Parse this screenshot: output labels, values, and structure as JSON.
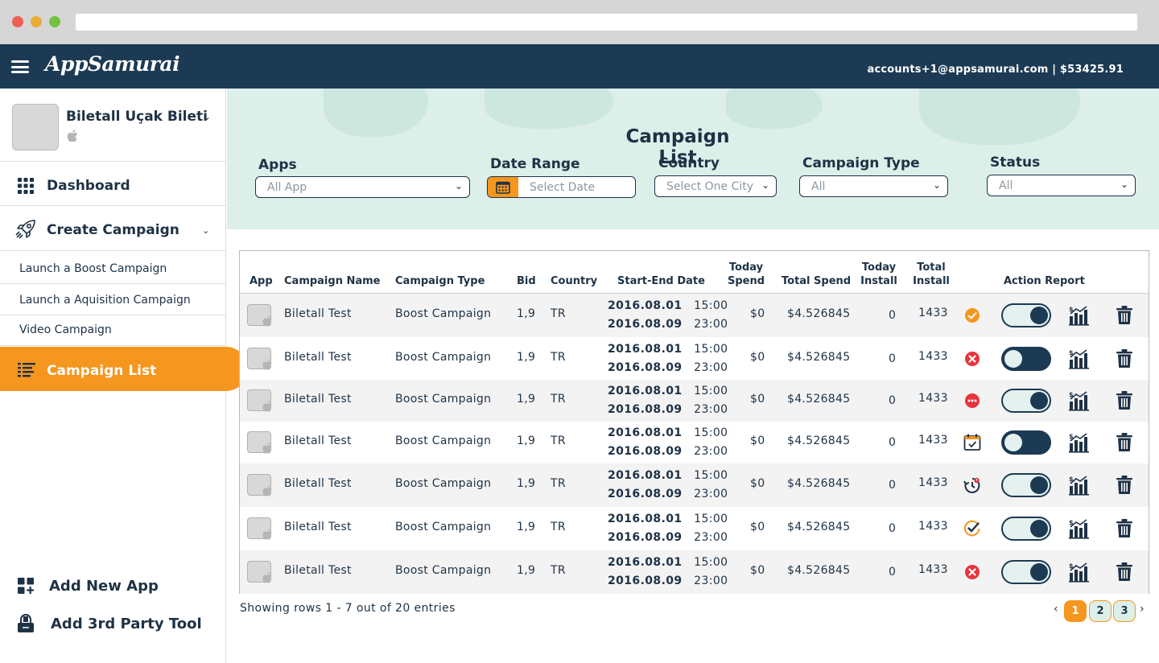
{
  "browser": {
    "url": ""
  },
  "topbar": {
    "logo": "AppSamurai",
    "account": "accounts+1@appsamurai.com | $53425.91"
  },
  "sidebar": {
    "app_name": "Biletall Uçak Bileti",
    "dashboard": "Dashboard",
    "create_campaign": "Create Campaign",
    "sub_items": [
      "Launch a Boost Campaign",
      "Launch a Aquisition Campaign",
      "Video Campaign"
    ],
    "campaign_list": "Campaign List",
    "add_new_app": "Add New App",
    "add_tool": "Add 3rd Party Tool",
    "accent": "#f5961e"
  },
  "filters": {
    "title": "Campaign List",
    "apps_label": "Apps",
    "apps_value": "All App",
    "date_label": "Date Range",
    "date_placeholder": "Select Date",
    "country_label": "Country",
    "country_value": "Select One City",
    "type_label": "Campaign Type",
    "type_value": "All",
    "status_label": "Status",
    "status_value": "All"
  },
  "table": {
    "headers": {
      "app": "App",
      "name": "Campaign Name",
      "type": "Campaign Type",
      "bid": "Bid",
      "country": "Country",
      "dates": "Start-End Date",
      "today_spend_1": "Today",
      "today_spend_2": "Spend",
      "total_spend": "Total Spend",
      "today_install_1": "Today",
      "today_install_2": "Install",
      "total_install_1": "Total",
      "total_install_2": "Install",
      "action_report": "Action Report"
    },
    "rows": [
      {
        "name": "Biletall Test",
        "type": "Boost Campaign",
        "bid": "1,9",
        "country": "TR",
        "start_date": "2016.08.01",
        "start_time": "15:00",
        "end_date": "2016.08.09",
        "end_time": "23:00",
        "today_spend": "$0",
        "total_spend": "$4.526845",
        "today_install": "0",
        "total_install": "1433",
        "status_icon": "check-circle-icon",
        "toggle": "on"
      },
      {
        "name": "Biletall Test",
        "type": "Boost Campaign",
        "bid": "1,9",
        "country": "TR",
        "start_date": "2016.08.01",
        "start_time": "15:00",
        "end_date": "2016.08.09",
        "end_time": "23:00",
        "today_spend": "$0",
        "total_spend": "$4.526845",
        "today_install": "0",
        "total_install": "1433",
        "status_icon": "error-circle-icon",
        "toggle": "off"
      },
      {
        "name": "Biletall Test",
        "type": "Boost Campaign",
        "bid": "1,9",
        "country": "TR",
        "start_date": "2016.08.01",
        "start_time": "15:00",
        "end_date": "2016.08.09",
        "end_time": "23:00",
        "today_spend": "$0",
        "total_spend": "$4.526845",
        "today_install": "0",
        "total_install": "1433",
        "status_icon": "pending-dots-icon",
        "toggle": "on"
      },
      {
        "name": "Biletall Test",
        "type": "Boost Campaign",
        "bid": "1,9",
        "country": "TR",
        "start_date": "2016.08.01",
        "start_time": "15:00",
        "end_date": "2016.08.09",
        "end_time": "23:00",
        "today_spend": "$0",
        "total_spend": "$4.526845",
        "today_install": "0",
        "total_install": "1433",
        "status_icon": "scheduled-calendar-icon",
        "toggle": "off"
      },
      {
        "name": "Biletall Test",
        "type": "Boost Campaign",
        "bid": "1,9",
        "country": "TR",
        "start_date": "2016.08.01",
        "start_time": "15:00",
        "end_date": "2016.08.09",
        "end_time": "23:00",
        "today_spend": "$0",
        "total_spend": "$4.526845",
        "today_install": "0",
        "total_install": "1433",
        "status_icon": "timer-alert-icon",
        "toggle": "on"
      },
      {
        "name": "Biletall Test",
        "type": "Boost Campaign",
        "bid": "1,9",
        "country": "TR",
        "start_date": "2016.08.01",
        "start_time": "15:00",
        "end_date": "2016.08.09",
        "end_time": "23:00",
        "today_spend": "$0",
        "total_spend": "$4.526845",
        "today_install": "0",
        "total_install": "1433",
        "status_icon": "completed-check-icon",
        "toggle": "on"
      },
      {
        "name": "Biletall Test",
        "type": "Boost Campaign",
        "bid": "1,9",
        "country": "TR",
        "start_date": "2016.08.01",
        "start_time": "15:00",
        "end_date": "2016.08.09",
        "end_time": "23:00",
        "today_spend": "$0",
        "total_spend": "$4.526845",
        "today_install": "0",
        "total_install": "1433",
        "status_icon": "error-circle-icon",
        "toggle": "on"
      }
    ]
  },
  "footer": {
    "showing": "Showing rows 1 - 7 out of 20 entries",
    "pages": [
      "1",
      "2",
      "3"
    ],
    "active_page": "1",
    "prev": "‹",
    "next": "›"
  }
}
